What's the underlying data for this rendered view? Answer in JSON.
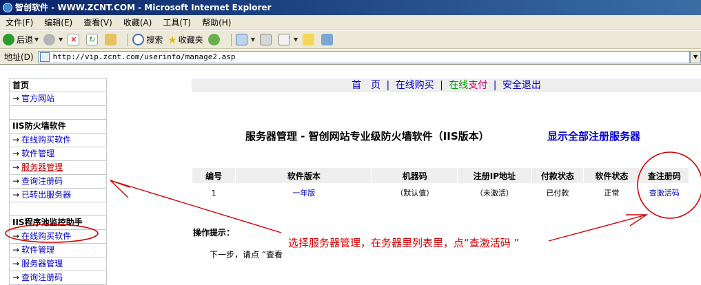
{
  "window": {
    "title": "智创软件 - WWW.ZCNT.COM - Microsoft Internet Explorer"
  },
  "menu": [
    "文件(F)",
    "编辑(E)",
    "查看(V)",
    "收藏(A)",
    "工具(T)",
    "帮助(H)"
  ],
  "toolbar": {
    "back": "后退",
    "search": "搜索",
    "favorites": "收藏夹"
  },
  "address": {
    "label": "地址(D)",
    "url": "http://vip.zcnt.com/userinfo/manage2.asp"
  },
  "sidebar": {
    "home_head": "首页",
    "official_site": "官方网站",
    "firewall_head": "IIS防火墙软件",
    "firewall_items": [
      "在线购买软件",
      "软件管理",
      "服务器管理",
      "查询注册码",
      "已转出服务器"
    ],
    "pool_head": "IIS程序池监控助手",
    "pool_items": [
      "在线购买软件",
      "软件管理",
      "服务器管理",
      "查询注册码"
    ],
    "arrow": "→"
  },
  "topnav": {
    "home": "首　页",
    "buy": "在线购买",
    "pay_a": "在线",
    "pay_b": "支付",
    "logout": "安全退出",
    "sep": "|"
  },
  "page": {
    "title": "服务器管理 - 智创网站专业级防火墙软件（IIS版本）",
    "show_all": "显示全部注册服务器",
    "tips_label": "操作提示：",
    "next_step": "下一步，请点 “查看"
  },
  "table": {
    "headers": [
      "编号",
      "软件版本",
      "机器码",
      "注册IP地址",
      "付款状态",
      "软件状态",
      "查注册码"
    ],
    "row": {
      "id": "1",
      "version": "一年版",
      "machine": "（默认值）",
      "ip": "（未激活）",
      "payment": "已付款",
      "status": "正常",
      "action": "查激活码"
    }
  },
  "annotation": {
    "text": "选择服务器管理，在务器里列表里，点“查激活码 ”",
    "color": "#d40000"
  }
}
